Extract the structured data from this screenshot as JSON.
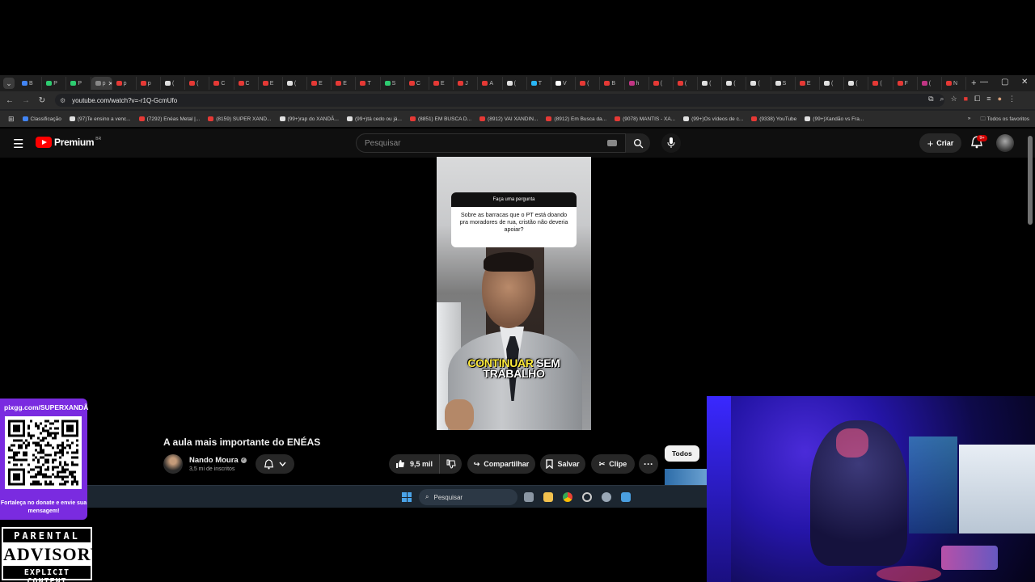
{
  "browser": {
    "tabs": [
      {
        "label": "B",
        "color": "#4285f4"
      },
      {
        "label": "P",
        "color": "#2ecc71"
      },
      {
        "label": "P",
        "color": "#2ecc71"
      },
      {
        "label": "p",
        "color": "#888888",
        "active": true
      },
      {
        "label": "p",
        "color": "#e53935"
      },
      {
        "label": "p",
        "color": "#e53935"
      },
      {
        "label": "(",
        "color": "#e0e0e0"
      },
      {
        "label": "(",
        "color": "#e53935"
      },
      {
        "label": "C",
        "color": "#e53935"
      },
      {
        "label": "C",
        "color": "#e53935"
      },
      {
        "label": "E",
        "color": "#e53935"
      },
      {
        "label": "(",
        "color": "#e0e0e0"
      },
      {
        "label": "E",
        "color": "#e53935"
      },
      {
        "label": "E",
        "color": "#e53935"
      },
      {
        "label": "T",
        "color": "#e53935"
      },
      {
        "label": "S",
        "color": "#2ecc71"
      },
      {
        "label": "C",
        "color": "#e53935"
      },
      {
        "label": "E",
        "color": "#e53935"
      },
      {
        "label": "J",
        "color": "#e53935"
      },
      {
        "label": "A",
        "color": "#e53935"
      },
      {
        "label": "(",
        "color": "#e0e0e0"
      },
      {
        "label": "T",
        "color": "#29b6f6"
      },
      {
        "label": "V",
        "color": "#ffffff"
      },
      {
        "label": "(",
        "color": "#e53935"
      },
      {
        "label": "B",
        "color": "#e53935"
      },
      {
        "label": "h",
        "color": "#c13584"
      },
      {
        "label": "(",
        "color": "#e53935"
      },
      {
        "label": "(",
        "color": "#e53935"
      },
      {
        "label": "(",
        "color": "#e0e0e0"
      },
      {
        "label": "(",
        "color": "#e0e0e0"
      },
      {
        "label": "(",
        "color": "#e0e0e0"
      },
      {
        "label": "S",
        "color": "#e0e0e0"
      },
      {
        "label": "E",
        "color": "#e53935"
      },
      {
        "label": "(",
        "color": "#e0e0e0"
      },
      {
        "label": "(",
        "color": "#e0e0e0"
      },
      {
        "label": "(",
        "color": "#e53935"
      },
      {
        "label": "F",
        "color": "#e53935"
      },
      {
        "label": "(",
        "color": "#c13584"
      },
      {
        "label": "N",
        "color": "#e53935"
      }
    ],
    "url": "youtube.com/watch?v=-r1Q-GcmUfo",
    "bookmarks": [
      {
        "label": "Classificação",
        "color": "#4285f4"
      },
      {
        "label": "(97)Te ensino a venc...",
        "color": "#e0e0e0"
      },
      {
        "label": "(7292) Enéas Metal |...",
        "color": "#e53935"
      },
      {
        "label": "(8159) SUPER XAND...",
        "color": "#e53935"
      },
      {
        "label": "(99+)rap do XANDÃ...",
        "color": "#e0e0e0"
      },
      {
        "label": "(99+)tá cedo ou já...",
        "color": "#e0e0e0"
      },
      {
        "label": "(8851) EM BUSCA D...",
        "color": "#e53935"
      },
      {
        "label": "(8912) VAI XANDIN...",
        "color": "#e53935"
      },
      {
        "label": "(8912) Em Busca da...",
        "color": "#e53935"
      },
      {
        "label": "(9078) MANTIS - XA...",
        "color": "#e53935"
      },
      {
        "label": "(99+)Os vídeos de c...",
        "color": "#e0e0e0"
      },
      {
        "label": "(9338) YouTube",
        "color": "#e53935"
      },
      {
        "label": "(99+)Xandão vs Fra...",
        "color": "#e0e0e0"
      }
    ],
    "bookmarks_more": "»",
    "all_favorites": "Todos os favoritos"
  },
  "youtube": {
    "logo_text": "Premium",
    "country": "BR",
    "search_placeholder": "Pesquisar",
    "create_label": "Criar",
    "notifications_badge": "9+"
  },
  "video": {
    "question_header": "Faça uma pergunta",
    "question_text": "Sobre as barracas que o PT está doando pra moradores de rua, cristão não deveria apoiar?",
    "caption_highlight": "CONTINUAR",
    "caption_rest": "SEM",
    "caption_line2": "TRABALHO"
  },
  "meta": {
    "title": "A aula mais importante do ENÉAS",
    "channel": "Nando Moura",
    "subscribers": "3,5 mi de inscritos",
    "likes": "9,5 mil",
    "share": "Compartilhar",
    "save": "Salvar",
    "clip": "Clipe",
    "more": "···",
    "filter_chip": "Todos"
  },
  "taskbar": {
    "search_placeholder": "Pesquisar"
  },
  "overlay": {
    "qr_url": "pixgg.com/SUPERXANDÃ",
    "qr_message": "Fortaleça no donate e envie sua mensagem!",
    "advisory_top": "PARENTAL",
    "advisory_mid": "ADVISORY",
    "advisory_bottom": "EXPLICIT CONTENT"
  }
}
